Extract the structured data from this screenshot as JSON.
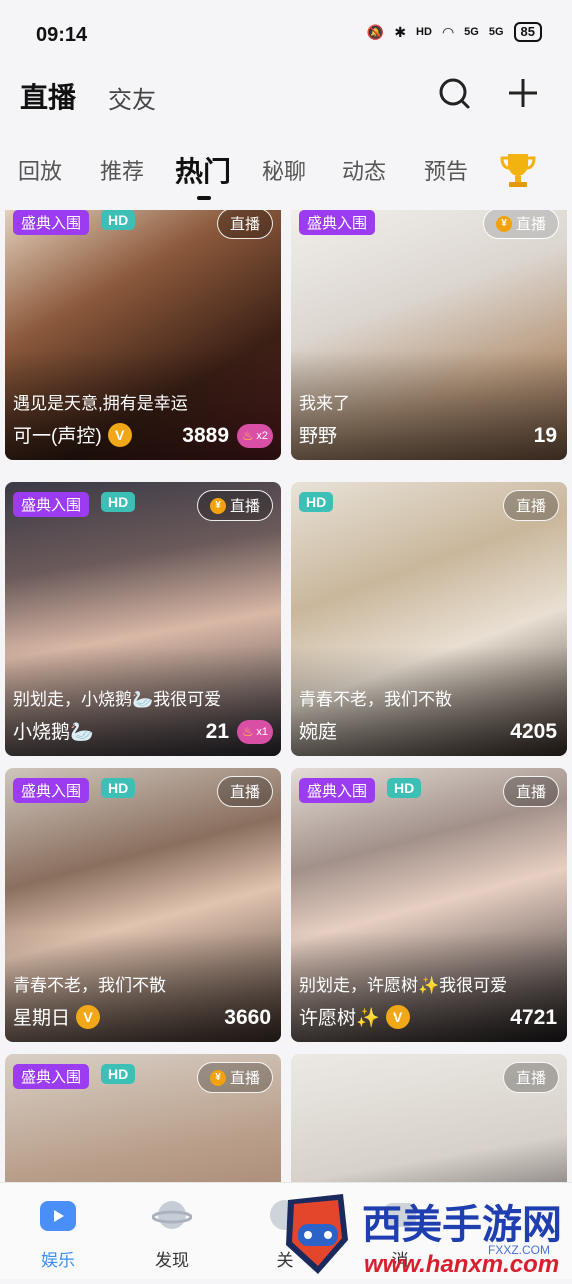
{
  "status_bar": {
    "time": "09:14",
    "battery": "85",
    "network1": "5G",
    "network2": "5G",
    "hd_label": "HD"
  },
  "header": {
    "title": "直播",
    "secondary": "交友",
    "search_icon": "search-icon",
    "add_icon": "plus-icon"
  },
  "tabs": [
    {
      "label": "回放"
    },
    {
      "label": "推荐"
    },
    {
      "label": "热门",
      "active": true
    },
    {
      "label": "秘聊"
    },
    {
      "label": "动态"
    },
    {
      "label": "预告"
    }
  ],
  "badges": {
    "shengdian": "盛典入围",
    "hd": "HD",
    "live": "直播"
  },
  "cards": [
    {
      "desc": "遇见是天意,拥有是幸运",
      "name": "可一(声控)",
      "count": "3889",
      "fire": "x2",
      "v": "V"
    },
    {
      "desc": "我来了",
      "name": "野野",
      "count": "19"
    },
    {
      "desc": "别划走，小烧鹅🦢我很可爱",
      "name": "小烧鹅🦢",
      "count": "21",
      "fire": "x1"
    },
    {
      "desc": "青春不老，我们不散",
      "name": "婉庭",
      "count": "4205"
    },
    {
      "desc": "青春不老，我们不散",
      "name": "星期日",
      "count": "3660",
      "v": "V"
    },
    {
      "desc": "别划走，许愿树✨我很可爱",
      "name": "许愿树✨",
      "count": "4721",
      "v": "V"
    },
    {
      "desc": "",
      "name": "",
      "count": ""
    },
    {
      "desc": "",
      "name": "",
      "count": ""
    }
  ],
  "bottom_nav": [
    {
      "label": "娱乐",
      "active": true
    },
    {
      "label": "发现"
    },
    {
      "label": "关"
    },
    {
      "label": "消"
    }
  ],
  "watermark": {
    "title": "西美手游网",
    "url": "www.hanxm.com",
    "sub": "FXXZ.COM"
  },
  "colors": {
    "accent": "#3b8ef6",
    "shengdian": "#9b3cf0",
    "hd": "#3cc0b6",
    "gold": "#f0a818"
  }
}
